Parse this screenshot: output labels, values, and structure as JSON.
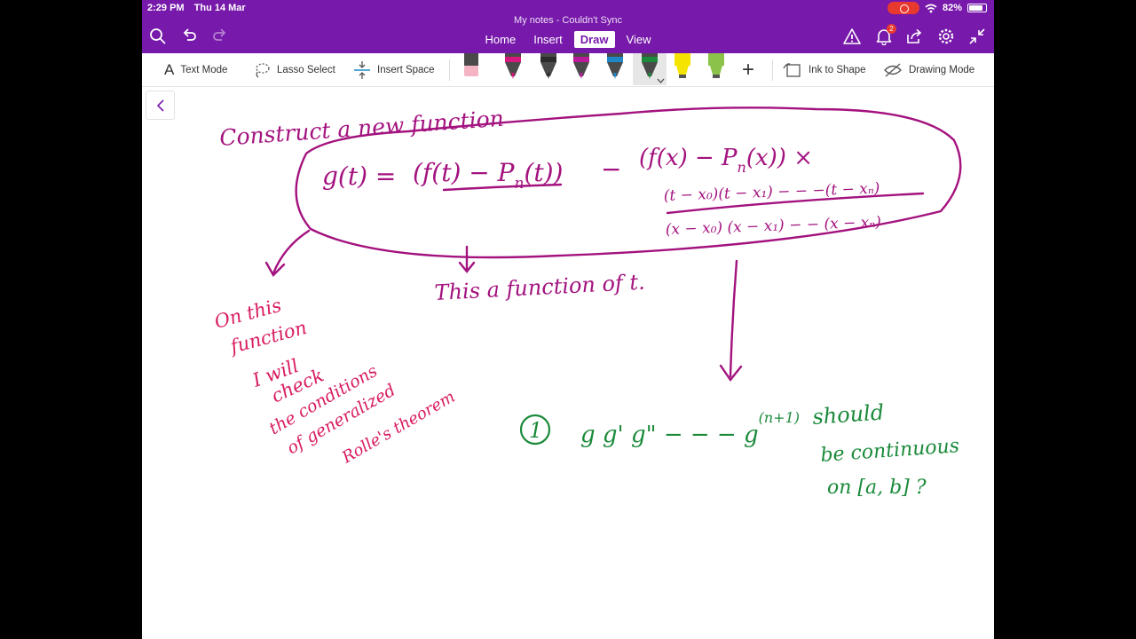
{
  "status": {
    "time": "2:29 PM",
    "date": "Thu 14 Mar",
    "battery": "82%",
    "battery_level": 0.82
  },
  "window": {
    "title": "My notes - Couldn't Sync"
  },
  "tabs": [
    {
      "label": "Home",
      "active": false
    },
    {
      "label": "Insert",
      "active": false
    },
    {
      "label": "Draw",
      "active": true
    },
    {
      "label": "View",
      "active": false
    }
  ],
  "notifications": {
    "count": "2"
  },
  "ribbon": {
    "text_mode": "Text Mode",
    "lasso_select": "Lasso Select",
    "insert_space": "Insert Space",
    "ink_to_shape": "Ink to Shape",
    "drawing_mode": "Drawing Mode",
    "text_mode_glyph": "A",
    "add_glyph": "+"
  },
  "pens": [
    {
      "name": "pen-eraser",
      "color": "#f4b4c4"
    },
    {
      "name": "pen-magenta",
      "color": "#d6177e"
    },
    {
      "name": "pen-black",
      "color": "#2b2b2b"
    },
    {
      "name": "pen-purple",
      "color": "#b81a9a"
    },
    {
      "name": "pen-blue",
      "color": "#1e88c7"
    },
    {
      "name": "pen-green",
      "color": "#1b8a3a"
    },
    {
      "name": "highlighter-yellow",
      "color": "#f5e400"
    },
    {
      "name": "highlighter-green",
      "color": "#8bc34a"
    }
  ],
  "colors": {
    "accent": "#7719AA",
    "ink_purple": "#a3127e",
    "ink_pink": "#d81b60",
    "ink_green": "#1b8a3a"
  },
  "note": {
    "heading": "Construct a new function",
    "lhs": "g(t) =",
    "term1": "(f(t) − P",
    "term1_sub": "n",
    "term1_end": "(t))",
    "minus": "−",
    "term2": "(f(x) − P",
    "term2_sub": "n",
    "term2_end": "(x)) ×",
    "numerator": "(t − x₀)(t − x₁) − − −(t − xₙ)",
    "denominator": "(x − x₀) (x − x₁) − − (x − xₙ)",
    "function_of_t": "This a function of t.",
    "side_note": [
      "On this",
      "function",
      "I will",
      "check",
      "the conditions",
      "of generalized",
      "Rolle's theorem"
    ],
    "circle_num": "1",
    "derivs": "g  g'  g\" − − −  g",
    "derivs_sup": "(n+1)",
    "should": "should",
    "be_continuous": "be continuous",
    "interval": "on [a, b] ?"
  }
}
